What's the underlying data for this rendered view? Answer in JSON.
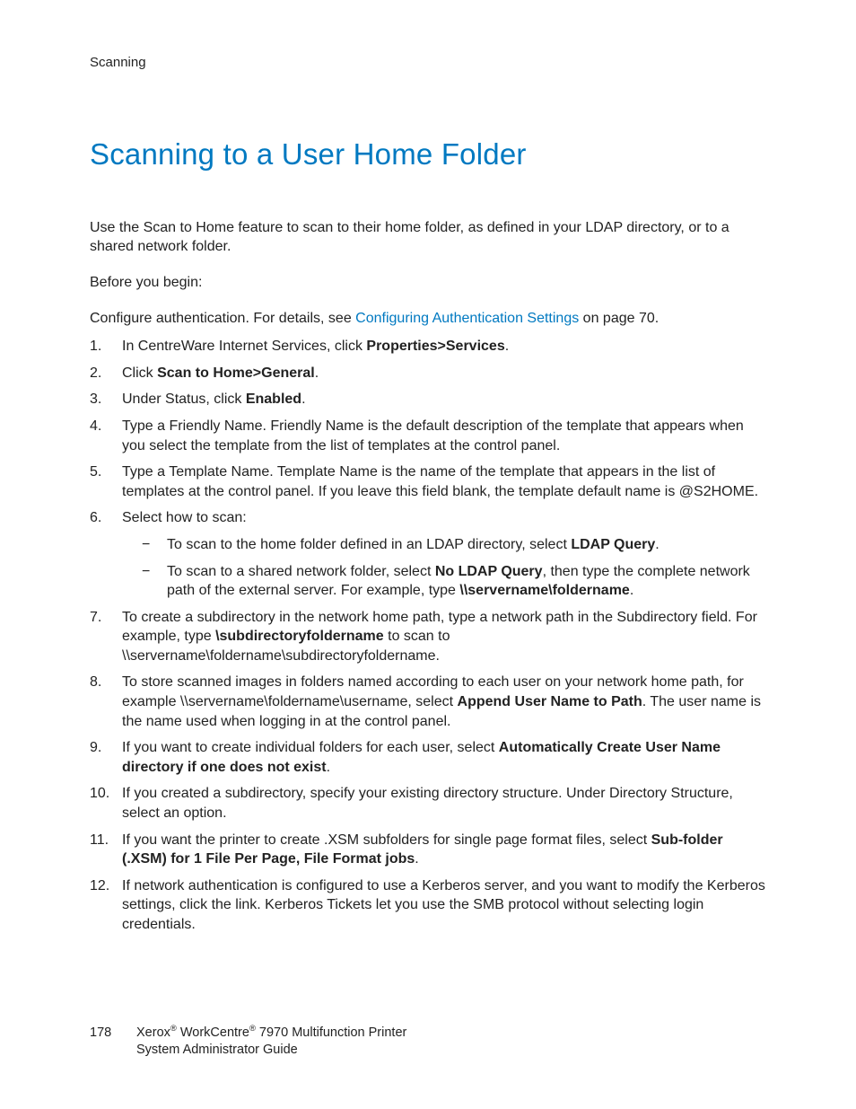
{
  "header": {
    "section": "Scanning"
  },
  "title": "Scanning to a User Home Folder",
  "intro": "Use the Scan to Home feature to scan to their home folder, as defined in your LDAP directory, or to a shared network folder.",
  "before": "Before you begin:",
  "config": {
    "pre": "Configure authentication. For details, see ",
    "link": "Configuring Authentication Settings",
    "post": " on page 70."
  },
  "steps": {
    "s1a": "In CentreWare Internet Services, click ",
    "s1b": "Properties>Services",
    "s1c": ".",
    "s2a": "Click ",
    "s2b": "Scan to Home>General",
    "s2c": ".",
    "s3a": "Under Status, click ",
    "s3b": "Enabled",
    "s3c": ".",
    "s4": "Type a Friendly Name. Friendly Name is the default description of the template that appears when you select the template from the list of templates at the control panel.",
    "s5": "Type a Template Name. Template Name is the name of the template that appears in the list of templates at the control panel. If you leave this field blank, the template default name is @S2HOME.",
    "s6": "Select how to scan:",
    "s6_1a": "To scan to the home folder defined in an LDAP directory, select ",
    "s6_1b": "LDAP Query",
    "s6_1c": ".",
    "s6_2a": "To scan to a shared network folder, select ",
    "s6_2b": "No LDAP Query",
    "s6_2c": ", then type the complete network path of the external server. For example, type ",
    "s6_2d": "\\\\servername\\foldername",
    "s6_2e": ".",
    "s7a": "To create a subdirectory in the network home path, type a network path in the Subdirectory field. For example, type ",
    "s7b": "\\subdirectoryfoldername",
    "s7c": " to scan to \\\\servername\\foldername\\subdirectoryfoldername.",
    "s8a": "To store scanned images in folders named according to each user on your network home path, for example \\\\servername\\foldername\\username, select ",
    "s8b": "Append User Name to Path",
    "s8c": ". The user name is the name used when logging in at the control panel.",
    "s9a": "If you want to create individual folders for each user, select ",
    "s9b": "Automatically Create User Name directory if one does not exist",
    "s9c": ".",
    "s10": "If you created a subdirectory, specify your existing directory structure. Under Directory Structure, select an option.",
    "s11a": "If you want the printer to create .XSM subfolders for single page format files, select ",
    "s11b": "Sub-folder (.XSM) for 1 File Per Page, File Format jobs",
    "s11c": ".",
    "s12": "If network authentication is configured to use a Kerberos server, and you want to modify the Kerberos settings, click the link. Kerberos Tickets let you use the SMB protocol without selecting login credentials."
  },
  "footer": {
    "page": "178",
    "l1a": "Xerox",
    "l1b": " WorkCentre",
    "l1c": " 7970 Multifunction Printer",
    "l2": "System Administrator Guide"
  }
}
